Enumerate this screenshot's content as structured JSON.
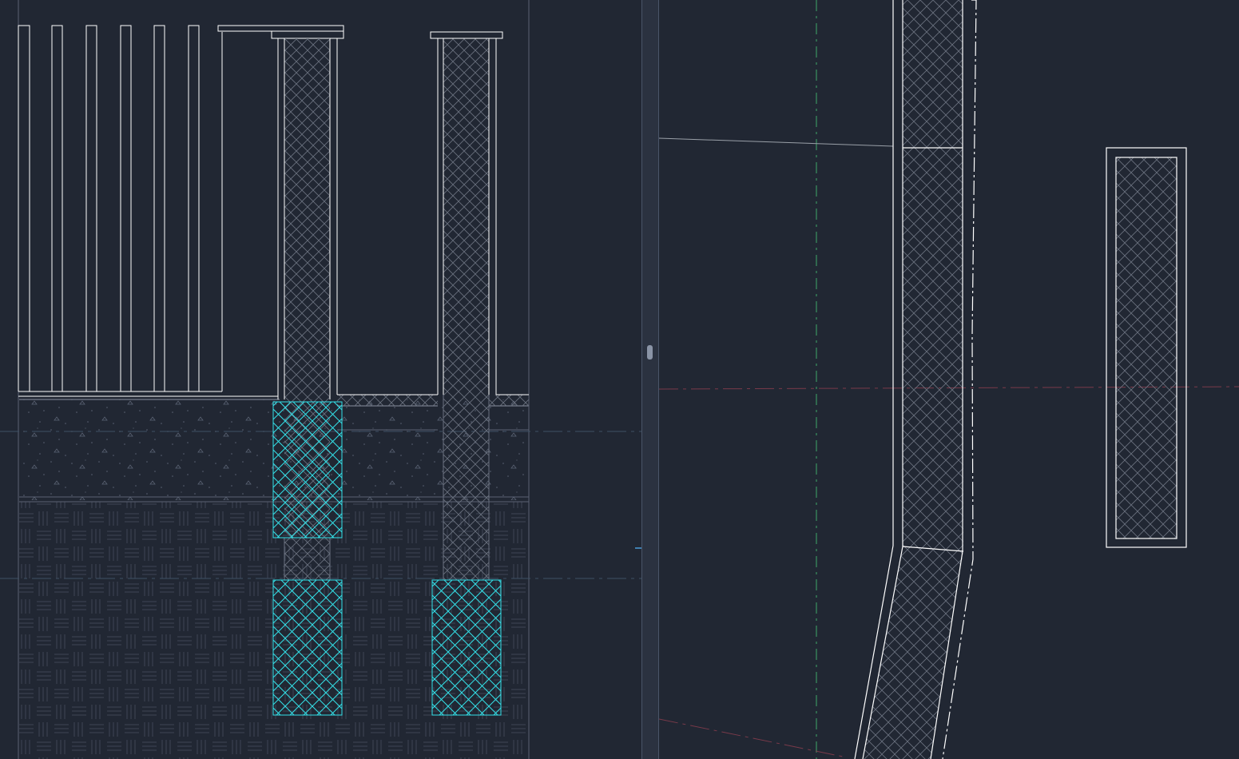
{
  "app": {
    "type": "cad-drawing-editor",
    "layout": "two-viewports-vertical-split"
  },
  "colors": {
    "background": "#212733",
    "linework": "#ffffff",
    "hatch_highlight": "#33e0e8",
    "hatch_gray": "#6b7280",
    "centerline": "#3f5266",
    "centerline_green": "#3fa868",
    "centerline_red": "#7a3a4a",
    "splitter": "#2b3240",
    "splitter_handle": "#8a94a6"
  },
  "viewports": [
    {
      "name": "section-elevation-view",
      "content": "wall-section-with-footings"
    },
    {
      "name": "plan-view",
      "content": "wall-and-column-plan"
    }
  ],
  "icons": {
    "splitter": "splitter-handle-icon"
  }
}
